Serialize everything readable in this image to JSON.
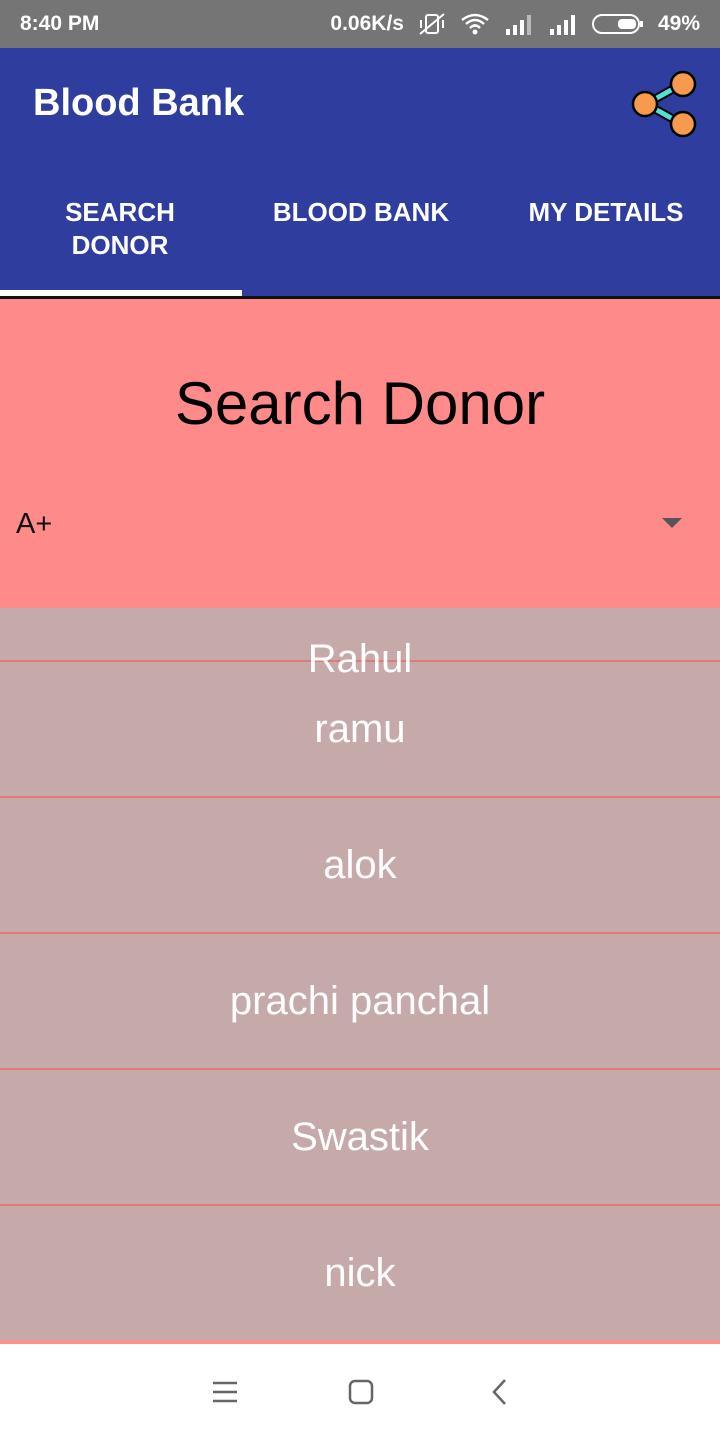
{
  "status_bar": {
    "time": "8:40 PM",
    "network_speed": "0.06K/s",
    "battery": "49%",
    "icons": [
      "vibrate-off-icon",
      "wifi-icon",
      "signal-icon",
      "signal-icon",
      "battery-icon"
    ]
  },
  "app_bar": {
    "title": "Blood Bank",
    "share_icon": "share-icon",
    "background": "#2f3d9e"
  },
  "tabs": [
    {
      "label": "SEARCH\nDONOR",
      "selected": true
    },
    {
      "label": "BLOOD BANK",
      "selected": false
    },
    {
      "label": "MY DETAILS",
      "selected": false
    }
  ],
  "search": {
    "title": "Search Donor",
    "blood_group": "A+",
    "background": "#ff8a8a"
  },
  "donors": [
    "Rahul",
    "ramu",
    "alok",
    "prachi panchal",
    "Swastik",
    "nick"
  ],
  "nav_bar": {
    "icons": [
      "menu-icon",
      "home-square-icon",
      "back-icon"
    ]
  }
}
